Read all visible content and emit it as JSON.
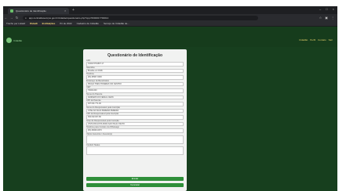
{
  "browser": {
    "tab_title": "Questionário de Identificação",
    "url": "app.centraldeseviços.gov.br/cidadao/questionario.php?cpp=5000017700014",
    "bookmarks": [
      "Trecho per Listadr",
      "Rstadt",
      "Instituições",
      "Pri de 2022",
      "Cadastro de Cidadão",
      "Serviço de Cidadão de..."
    ]
  },
  "header": {
    "logo_text": "Cidadão",
    "nav": [
      "Cidadão",
      "Perfil",
      "Contato",
      "Sair"
    ]
  },
  "form": {
    "title": "Questionário de Identificação",
    "fields": [
      {
        "label": "CPF",
        "value": "01202-5701807-17"
      },
      {
        "label": "Nascidos",
        "value": "Brasília em 03/96"
      },
      {
        "label": "Telefone",
        "value": "(84) 98937-0000"
      },
      {
        "label": "Endereço do Beneficiário",
        "value": "PRAÇA TRÊS PODERES S/N CENTRO"
      },
      {
        "label": "CEP",
        "value": "70000-000"
      },
      {
        "label": "Nome do Parente",
        "value": "JENIFERS DO FEDE E CERN"
      },
      {
        "label": "CPF do Parente",
        "value": "007.001.771-06"
      },
      {
        "label": "Nome do Responsável pela Inscrição",
        "value": "JOSÉ DA SILVA PEREIRA PEREIRA"
      },
      {
        "label": "CPF do Responsável pela Inscrição",
        "value": "994.002.007-80"
      },
      {
        "label": "Grau de Responsável pela Inscrição",
        "value": "VISTA PAULISTA PARA SÃO PAULO MATO"
      },
      {
        "label": "Telefone para Contato via Whatsapp",
        "value": "(84) 99000-0070"
      },
      {
        "label": "Vários Assuntos / Assunto(s)",
        "value": ""
      },
      {
        "label": "Conferir Status",
        "value": ""
      }
    ],
    "submit_label": "Enviar",
    "cancel_label": "Cancelar"
  },
  "colors": {
    "page_bg": "#173f1e",
    "header_bg": "#163c1c",
    "card_bg": "#f1f2f1",
    "button": "#2f8f3a",
    "nav_text": "#e9d26b"
  }
}
